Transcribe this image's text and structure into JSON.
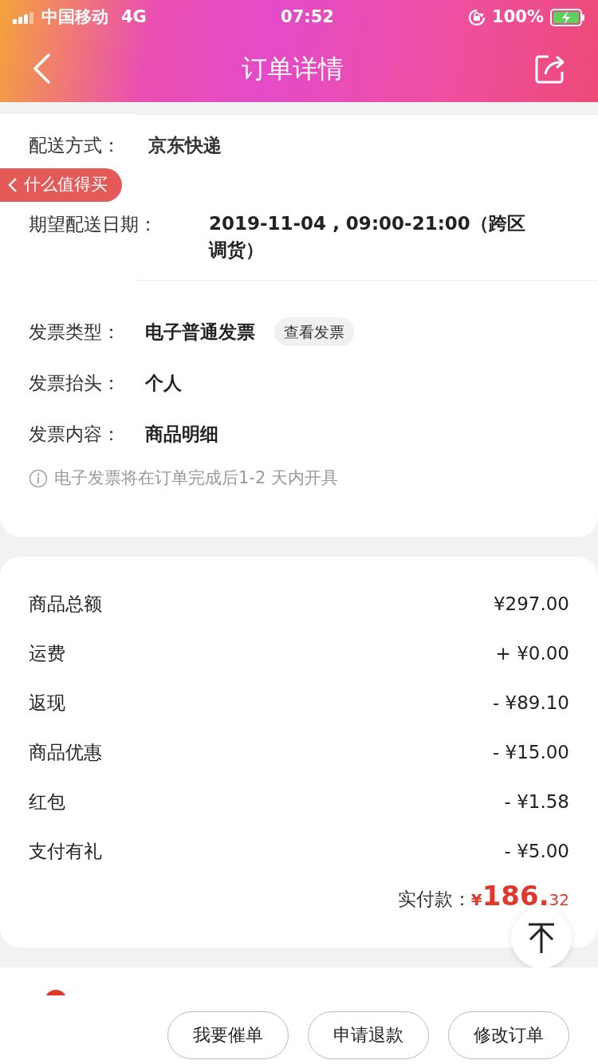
{
  "status_bar": {
    "carrier": "中国移动",
    "network": "4G",
    "time": "07:52",
    "battery": "100%"
  },
  "header": {
    "title": "订单详情"
  },
  "float_tag": {
    "label": "什么值得买"
  },
  "delivery": [
    {
      "label": "配送方式：",
      "value": "京东快递"
    },
    {
      "label": "期望配送日期：",
      "value": "2019-11-04 , 09:00-21:00（跨区调货）"
    }
  ],
  "invoice": {
    "rows": [
      {
        "label": "发票类型：",
        "value": "电子普通发票",
        "action": "查看发票"
      },
      {
        "label": "发票抬头：",
        "value": "个人"
      },
      {
        "label": "发票内容：",
        "value": "商品明细"
      }
    ],
    "note": "电子发票将在订单完成后1-2 天内开具"
  },
  "amounts": [
    {
      "label": "商品总额",
      "value": "¥297.00"
    },
    {
      "label": "运费",
      "value": "+ ¥0.00"
    },
    {
      "label": "返现",
      "value": "- ¥89.10"
    },
    {
      "label": "商品优惠",
      "value": "- ¥15.00"
    },
    {
      "label": "红包",
      "value": "- ¥1.58"
    },
    {
      "label": "支付有礼",
      "value": "- ¥5.00"
    }
  ],
  "total": {
    "label": "实付款：",
    "currency": "¥",
    "integer": "186.",
    "decimals": "32"
  },
  "actions": [
    "我要催单",
    "申请退款",
    "修改订单"
  ]
}
